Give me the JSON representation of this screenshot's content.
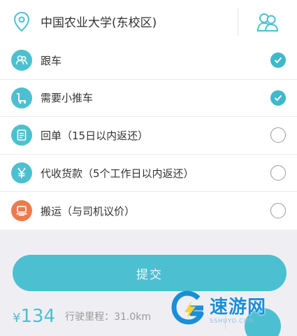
{
  "location": {
    "icon": "location-pin-icon",
    "text": "中国农业大学(东校区)",
    "contacts_icon": "contacts-icon"
  },
  "options": [
    {
      "label": "跟车",
      "icon": "people-icon",
      "icon_color": "#4cc0d0",
      "checked": true
    },
    {
      "label": "需要小推车",
      "icon": "cart-icon",
      "icon_color": "#4cc0d0",
      "checked": true
    },
    {
      "label": "回单（15日以内返还）",
      "icon": "receipt-icon",
      "icon_color": "#4cc0d0",
      "checked": false
    },
    {
      "label": "代收货款（5个工作日以内返还）",
      "icon": "yen-icon",
      "icon_color": "#4cc0d0",
      "checked": false
    },
    {
      "label": "搬运（与司机议价）",
      "icon": "moving-icon",
      "icon_color": "#ee7a4c",
      "checked": false
    }
  ],
  "submit": {
    "label": "提交"
  },
  "footer": {
    "currency": "¥",
    "price": "134",
    "distance": "行驶里程：31.0km"
  },
  "watermark": {
    "text": "速游网",
    "sub": "SSHUYO.COM"
  },
  "colors": {
    "accent": "#4cc0d0",
    "orange": "#ee7a4c",
    "background": "#efeff3"
  }
}
